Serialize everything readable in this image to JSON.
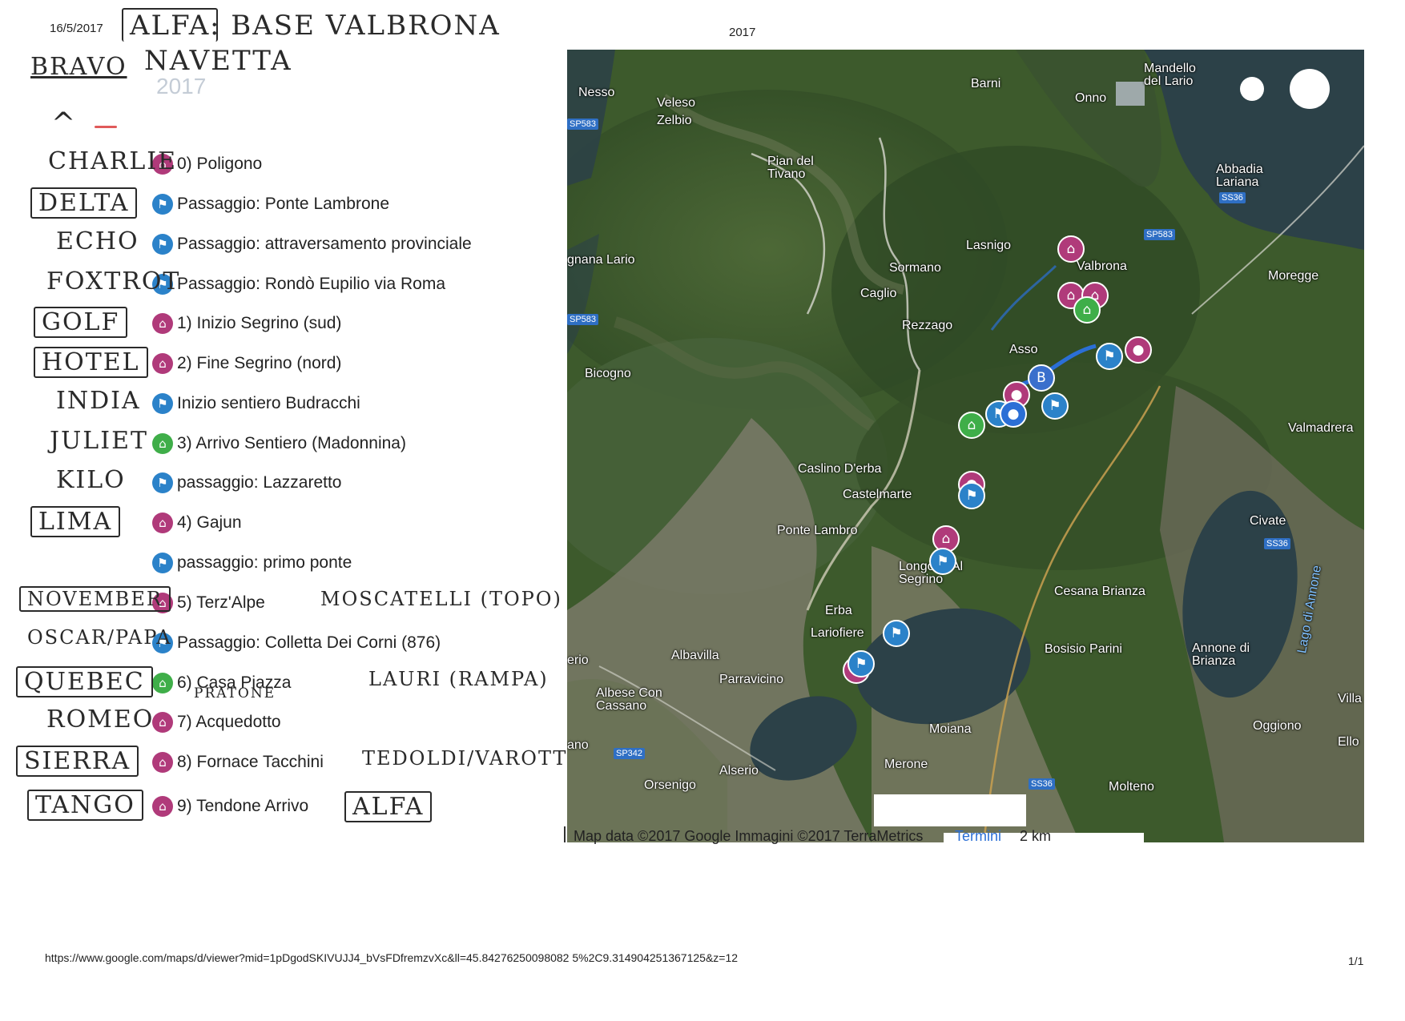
{
  "header": {
    "date": "16/5/2017",
    "base_label": "ALFA",
    "base_text": ": BASE VALBRONA",
    "shuttle_label": "BRAVO",
    "shuttle_text": "NAVETTA",
    "year_faded": "2017",
    "map_year": "2017"
  },
  "legend": [
    {
      "code": "CHARLIE",
      "boxed": false,
      "icon": "home-icon",
      "color": "#b03a7a",
      "label": "0) Poligono"
    },
    {
      "code": "DELTA",
      "boxed": true,
      "icon": "hiker-icon",
      "color": "#2b82c9",
      "label": "Passaggio: Ponte Lambrone"
    },
    {
      "code": "ECHO",
      "boxed": false,
      "icon": "hiker-icon",
      "color": "#2b82c9",
      "label": "Passaggio: attraversamento provinciale"
    },
    {
      "code": "FOXTROT",
      "boxed": false,
      "icon": "hiker-icon",
      "color": "#2b82c9",
      "label": "Passaggio: Rondò Eupilio via Roma"
    },
    {
      "code": "GOLF",
      "boxed": true,
      "icon": "home-icon",
      "color": "#b03a7a",
      "label": "1) Inizio Segrino (sud)"
    },
    {
      "code": "HOTEL",
      "boxed": true,
      "icon": "home-icon",
      "color": "#b03a7a",
      "label": "2) Fine Segrino (nord)"
    },
    {
      "code": "INDIA",
      "boxed": false,
      "icon": "hiker-icon",
      "color": "#2b82c9",
      "label": "Inizio sentiero Budracchi"
    },
    {
      "code": "JULIET",
      "boxed": false,
      "icon": "home-icon",
      "color": "#3fae49",
      "label": "3) Arrivo Sentiero (Madonnina)"
    },
    {
      "code": "KILO",
      "boxed": false,
      "icon": "hiker-icon",
      "color": "#2b82c9",
      "label": "passaggio: Lazzaretto"
    },
    {
      "code": "LIMA",
      "boxed": true,
      "icon": "home-icon",
      "color": "#b03a7a",
      "label": "4) Gajun"
    },
    {
      "code": "",
      "boxed": false,
      "icon": "hiker-icon",
      "color": "#2b82c9",
      "label": "passaggio: primo ponte"
    },
    {
      "code": "NOVEMBER",
      "boxed": true,
      "icon": "home-icon",
      "color": "#b03a7a",
      "label": "5) Terz'Alpe",
      "note": "MOSCATELLI (TOPO)"
    },
    {
      "code": "OSCAR/PAPA",
      "boxed": false,
      "icon": "hiker-icon",
      "color": "#2b82c9",
      "label": "Passaggio: Colletta Dei Corni (876)"
    },
    {
      "code": "QUEBEC",
      "boxed": true,
      "icon": "home-icon",
      "color": "#3fae49",
      "label": "6) Casa Piazza",
      "sub": "PRATONE",
      "note": "LAURI (RAMPA)"
    },
    {
      "code": "ROMEO",
      "boxed": false,
      "icon": "home-icon",
      "color": "#b03a7a",
      "label": "7) Acquedotto"
    },
    {
      "code": "SIERRA",
      "boxed": true,
      "icon": "home-icon",
      "color": "#b03a7a",
      "label": "8) Fornace Tacchini",
      "note": "TEDOLDI/VAROTTO"
    },
    {
      "code": "TANGO",
      "boxed": true,
      "icon": "home-icon",
      "color": "#b03a7a",
      "label": "9) Tendone Arrivo",
      "note": "ALFA"
    }
  ],
  "map": {
    "places": [
      "Nesso",
      "Veleso",
      "Zelbio",
      "Barni",
      "Mandello del Lario",
      "Onno",
      "Pian del Tivano",
      "Abbadia Lariana",
      "gnana Lario",
      "Lasnigo",
      "Sormano",
      "Valbrona",
      "Moregge",
      "Caglio",
      "Rezzago",
      "Asso",
      "Bicogno",
      "Valmadrera",
      "Caslino D'erba",
      "Castelmarte",
      "Ponte Lambro",
      "Civate",
      "Longone Al Segrino",
      "Cesana Brianza",
      "Erba",
      "Lariofiere",
      "Albavilla",
      "Bosisio Parini",
      "Annone di Brianza",
      "Lago di Annone",
      "Parravicino",
      "Albese Con Cassano",
      "Villa",
      "Moiana",
      "Oggiono",
      "Ello",
      "Alserio",
      "Merone",
      "Orsenigo",
      "Molteno",
      "erio",
      "ano",
      "Ca"
    ],
    "roads": [
      "SP583",
      "SS36",
      "SP583",
      "SP583",
      "SS36",
      "SP342",
      "SS36"
    ],
    "footer_attribution": "Map data ©2017 Google Immagini ©2017 TerraMetrics",
    "footer_terms": "Termini",
    "footer_scale": "2 km",
    "colors": {
      "forest": "#3d5a2c",
      "lake": "#2c4148",
      "urban": "#8a8678",
      "route": "#2b6fd6"
    }
  },
  "footer": {
    "url": "https://www.google.com/maps/d/viewer?mid=1pDgodSKIVUJJ4_bVsFDfremzvXc&ll=45.84276250098082 5%2C9.314904251367125&z=12",
    "page": "1/1"
  }
}
